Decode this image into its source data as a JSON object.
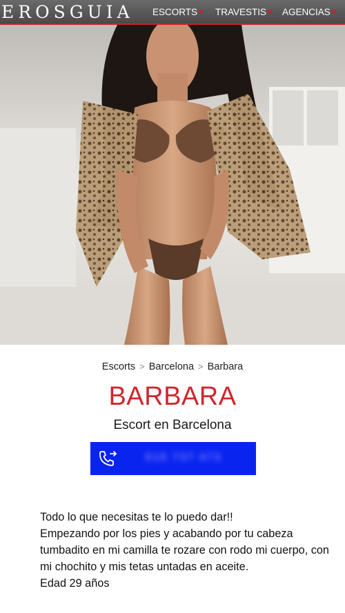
{
  "header": {
    "logo": "EROSGUIA",
    "nav": [
      {
        "label": "ESCORTS"
      },
      {
        "label": "TRAVESTIS"
      },
      {
        "label": "AGENCIAS"
      }
    ],
    "accent_color": "#d21d2a"
  },
  "hero": {
    "alt": "profile-photo"
  },
  "breadcrumb": {
    "items": [
      "Escorts",
      "Barcelona",
      "Barbara"
    ],
    "separator": ">"
  },
  "profile": {
    "name": "BARBARA",
    "subtitle": "Escort en Barcelona",
    "name_color": "#d0262d"
  },
  "call_button": {
    "phone": "616 737 473",
    "icon": "phone-forward-icon",
    "color": "#0a24f0"
  },
  "description": {
    "lines": [
      "Todo lo que necesitas te lo puedo dar!!",
      "Empezando por los pies y acabando por tu cabeza tumbadito en mi camilla te rozare con rodo mi cuerpo, con mi chochito y mis tetas untadas en aceite.",
      "Edad 29 años"
    ]
  }
}
